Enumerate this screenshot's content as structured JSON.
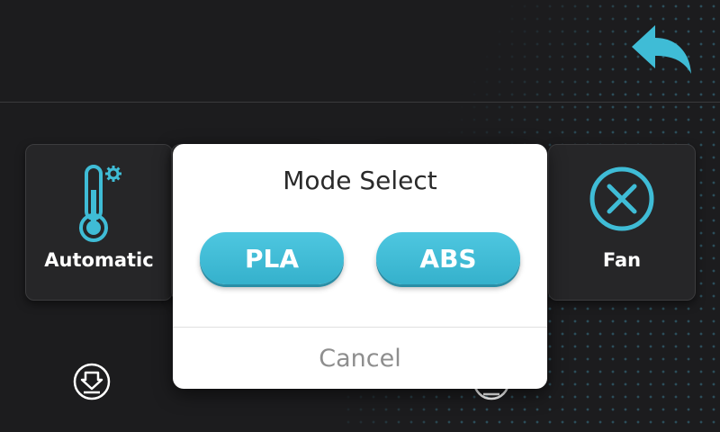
{
  "colors": {
    "background": "#1c1c1e",
    "accent": "#3fbcd6",
    "tile": "#262628",
    "modal": "#ffffff",
    "cancel_text": "#8e8e8e"
  },
  "header": {
    "back_icon": "undo-arrow-icon"
  },
  "tiles": [
    {
      "label": "Automatic",
      "icon": "thermometer-gear-icon"
    },
    {
      "label": "Fan",
      "icon": "circle-x-icon"
    }
  ],
  "bottom_icons": [
    "download-icon",
    "list-icon"
  ],
  "dialog": {
    "title": "Mode Select",
    "options": [
      "PLA",
      "ABS"
    ],
    "cancel_label": "Cancel"
  }
}
